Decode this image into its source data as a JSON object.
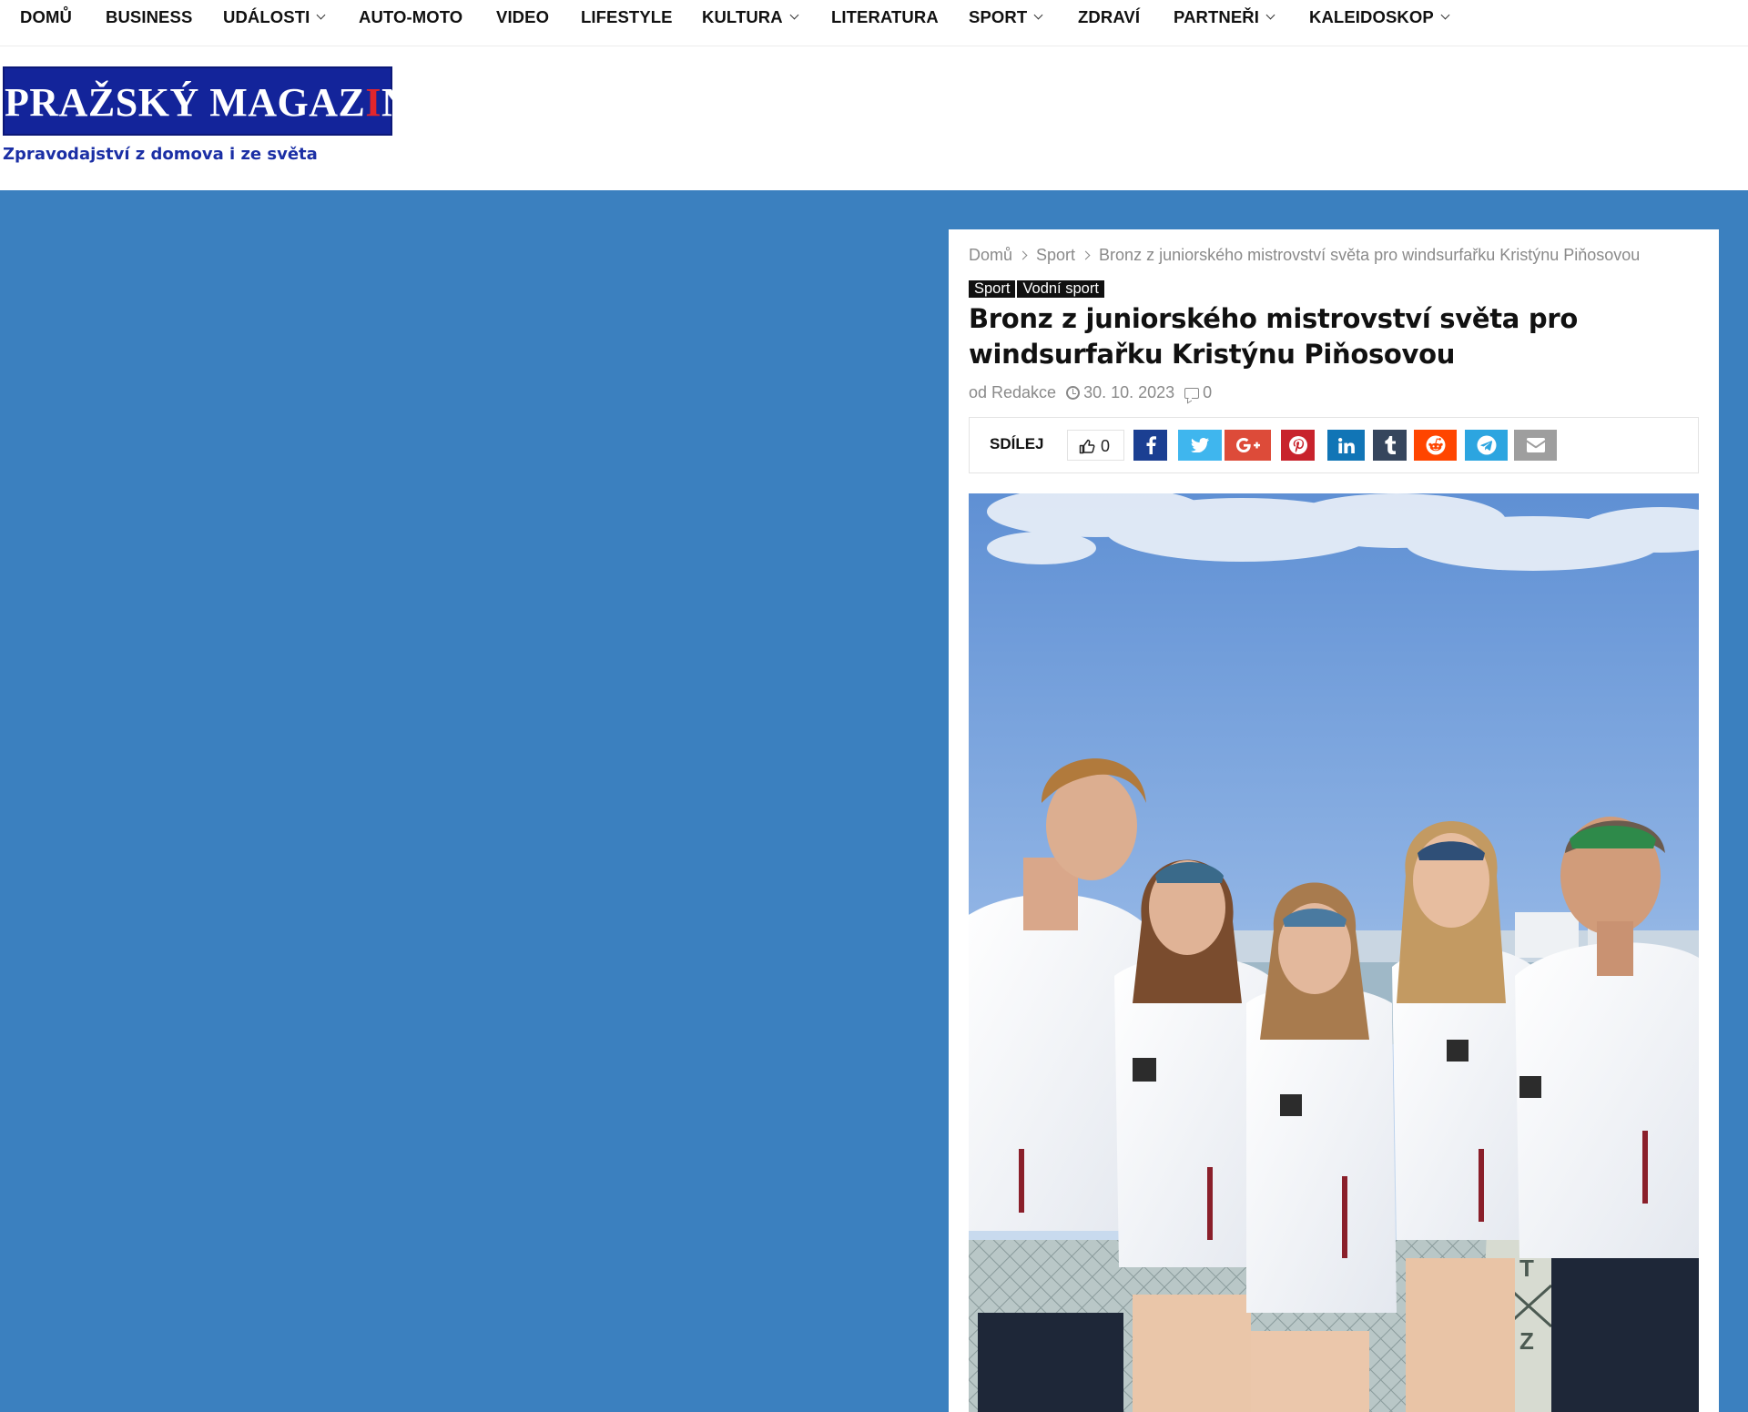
{
  "nav": {
    "items": [
      {
        "label": "DOMŮ",
        "dropdown": false
      },
      {
        "label": "BUSINESS",
        "dropdown": false
      },
      {
        "label": "UDÁLOSTI",
        "dropdown": true
      },
      {
        "label": "AUTO-MOTO",
        "dropdown": false
      },
      {
        "label": "VIDEO",
        "dropdown": false
      },
      {
        "label": "LIFESTYLE",
        "dropdown": false
      },
      {
        "label": "KULTURA",
        "dropdown": true
      },
      {
        "label": "LITERATURA",
        "dropdown": false
      },
      {
        "label": "SPORT",
        "dropdown": true
      },
      {
        "label": "ZDRAVÍ",
        "dropdown": false
      },
      {
        "label": "PARTNEŘI",
        "dropdown": true
      },
      {
        "label": "KALEIDOSKOP",
        "dropdown": true
      }
    ]
  },
  "header": {
    "logo_main": "PRAŽSKÝ MAGAZ",
    "logo_accent": "I",
    "logo_end": "N",
    "tagline": "Zpravodajství z domova i ze světa",
    "logo_bg_color": "#13249a",
    "accent_color": "#e3262c"
  },
  "page": {
    "background_color": "#3b80bf"
  },
  "article": {
    "breadcrumb": [
      "Domů",
      "Sport",
      "Bronz z juniorského mistrovství světa pro windsurfařku Kristýnu Piňosovou"
    ],
    "categories": [
      "Sport",
      "Vodní sport"
    ],
    "title": "Bronz z juniorského mistrovství světa pro windsurfařku Kristýnu Piňosovou",
    "author": "od Redakce",
    "date": "30. 10. 2023",
    "comments": "0"
  },
  "share": {
    "label": "SDÍLEJ",
    "likes": "0",
    "buttons": [
      {
        "name": "facebook",
        "icon": "facebook-icon",
        "color": "#1b3f92"
      },
      {
        "name": "twitter",
        "icon": "twitter-icon",
        "color": "#3fb6ee"
      },
      {
        "name": "google-plus",
        "icon": "google-plus-icon",
        "color": "#dd4b39"
      },
      {
        "name": "pinterest",
        "icon": "pinterest-icon",
        "color": "#c8232c"
      },
      {
        "name": "linkedin",
        "icon": "linkedin-icon",
        "color": "#1175b6"
      },
      {
        "name": "tumblr",
        "icon": "tumblr-icon",
        "color": "#36465d"
      },
      {
        "name": "reddit",
        "icon": "reddit-icon",
        "color": "#ff4500"
      },
      {
        "name": "telegram",
        "icon": "telegram-icon",
        "color": "#2ca5e0"
      },
      {
        "name": "email",
        "icon": "email-icon",
        "color": "#9e9e9e"
      }
    ]
  },
  "photo": {
    "letters": [
      "T",
      "Z"
    ]
  }
}
